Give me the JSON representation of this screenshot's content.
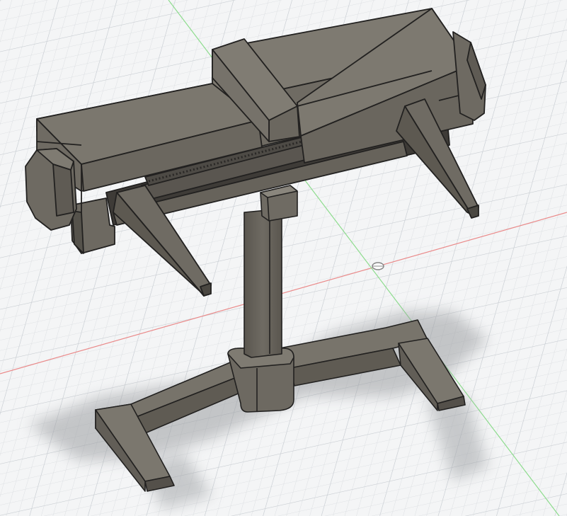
{
  "scene": {
    "view": "3d-viewport",
    "model": "vise-on-stand",
    "colors": {
      "background": "#f4f5f6",
      "grid_minor": "#dfe2e5",
      "grid_major": "#c7ccd1",
      "x_axis": "#e8787a",
      "y_axis": "#7ad67a",
      "body_top": "#7b776e",
      "body_front": "#6b665e",
      "body_side": "#5d5951",
      "body_dark": "#4a4741",
      "edge": "#222120",
      "shadow": "#a9abad"
    }
  }
}
